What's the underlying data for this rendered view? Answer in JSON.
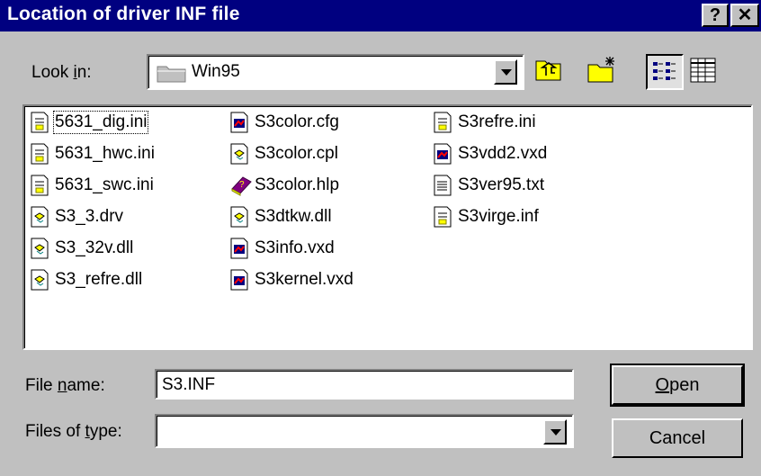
{
  "window": {
    "title": "Location of driver INF file",
    "help_glyph": "?",
    "close_glyph": "✕"
  },
  "look_in": {
    "label_pre": "Look ",
    "label_u": "i",
    "label_post": "n:",
    "value": "Win95"
  },
  "files": [
    {
      "name": "5631_dig.ini",
      "icon": "ini-file-icon"
    },
    {
      "name": "5631_hwc.ini",
      "icon": "ini-file-icon"
    },
    {
      "name": "5631_swc.ini",
      "icon": "ini-file-icon"
    },
    {
      "name": "S3_3.drv",
      "icon": "system-file-icon"
    },
    {
      "name": "S3_32v.dll",
      "icon": "system-file-icon"
    },
    {
      "name": "S3_refre.dll",
      "icon": "system-file-icon"
    },
    {
      "name": "S3color.cfg",
      "icon": "driver-file-icon"
    },
    {
      "name": "S3color.cpl",
      "icon": "system-file-icon"
    },
    {
      "name": "S3color.hlp",
      "icon": "help-book-icon"
    },
    {
      "name": "S3dtkw.dll",
      "icon": "system-file-icon"
    },
    {
      "name": "S3info.vxd",
      "icon": "driver-file-icon"
    },
    {
      "name": "S3kernel.vxd",
      "icon": "driver-file-icon"
    },
    {
      "name": "S3refre.ini",
      "icon": "ini-file-icon"
    },
    {
      "name": "S3vdd2.vxd",
      "icon": "driver-file-icon"
    },
    {
      "name": "S3ver95.txt",
      "icon": "text-file-icon"
    },
    {
      "name": "S3virge.inf",
      "icon": "ini-file-icon"
    }
  ],
  "file_name": {
    "label_pre": "File ",
    "label_u": "n",
    "label_post": "ame:",
    "value": "S3.INF"
  },
  "files_of_type": {
    "label_pre": "Files of ",
    "label_u": "t",
    "label_post": "ype:",
    "value": ""
  },
  "buttons": {
    "open_u": "O",
    "open_rest": "pen",
    "cancel": "Cancel"
  },
  "colors": {
    "title_bar": "#000080",
    "face": "#c0c0c0",
    "window": "#ffffff"
  }
}
